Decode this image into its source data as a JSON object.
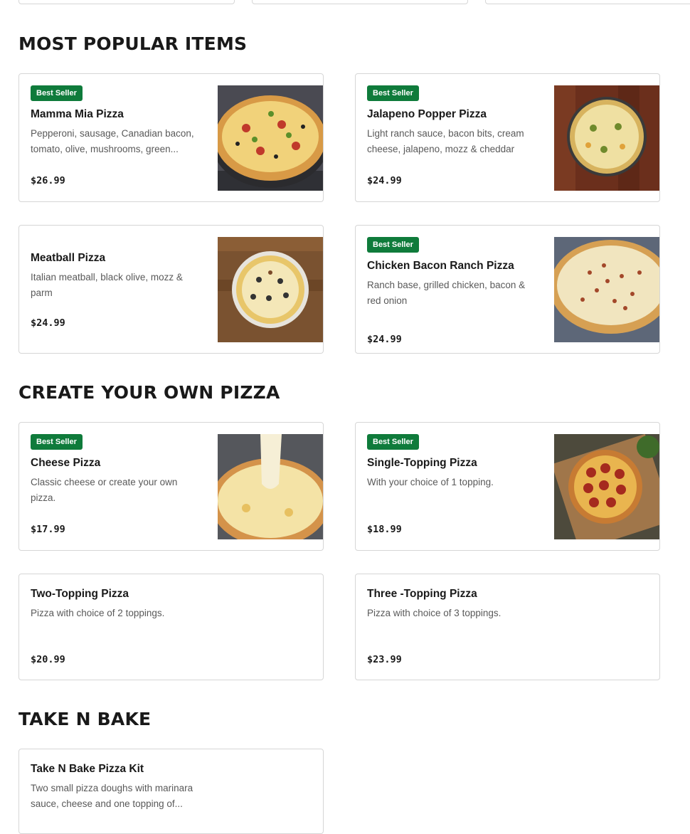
{
  "sections": [
    {
      "title": "MOST POPULAR ITEMS",
      "items": [
        {
          "badge": "Best Seller",
          "name": "Mamma Mia Pizza",
          "description": "Pepperoni, sausage, Canadian bacon, tomato, olive, mushrooms, green...",
          "price": "$26.99"
        },
        {
          "badge": "Best Seller",
          "name": "Jalapeno Popper Pizza",
          "description": "Light ranch sauce, bacon bits, cream cheese, jalapeno, mozz & cheddar",
          "price": "$24.99"
        },
        {
          "badge": "",
          "name": "Meatball Pizza",
          "description": "Italian meatball, black olive, mozz & parm",
          "price": "$24.99"
        },
        {
          "badge": "Best Seller",
          "name": "Chicken Bacon Ranch Pizza",
          "description": "Ranch base, grilled chicken, bacon & red onion",
          "price": "$24.99"
        }
      ]
    },
    {
      "title": "CREATE YOUR OWN PIZZA",
      "items": [
        {
          "badge": "Best Seller",
          "name": "Cheese Pizza",
          "description": "Classic cheese or create your own pizza.",
          "price": "$17.99"
        },
        {
          "badge": "Best Seller",
          "name": "Single-Topping Pizza",
          "description": "With your choice of 1 topping.",
          "price": "$18.99"
        },
        {
          "badge": "",
          "name": "Two-Topping Pizza",
          "description": "Pizza with choice of 2 toppings.",
          "price": "$20.99"
        },
        {
          "badge": "",
          "name": "Three -Topping Pizza",
          "description": "Pizza with choice of 3 toppings.",
          "price": "$23.99"
        }
      ]
    },
    {
      "title": "TAKE N BAKE",
      "items": [
        {
          "badge": "",
          "name": "Take N Bake Pizza Kit",
          "description": "Two small pizza doughs with marinara sauce, cheese and one topping of...",
          "price": ""
        }
      ]
    }
  ],
  "colors": {
    "badge_bg": "#0f7b3b",
    "border": "#d6d6d6",
    "text": "#191919",
    "muted": "#595959"
  },
  "icons": [
    "pizza-photo"
  ]
}
